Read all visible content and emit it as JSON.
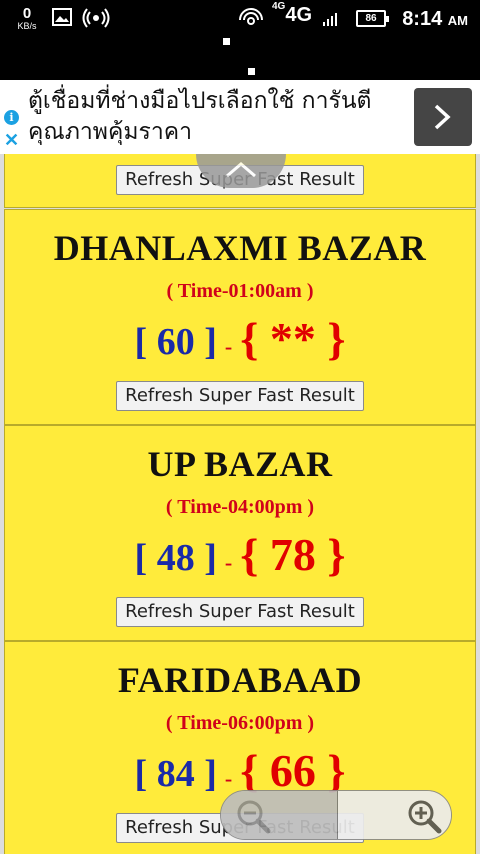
{
  "status_bar": {
    "speed_value": "0",
    "speed_unit": "KB/s",
    "network_sup": "4G",
    "network": "4G",
    "battery": "86",
    "time": "8:14",
    "ampm": "AM"
  },
  "ad": {
    "text": "ตู้เชื่อมที่ช่างมือไปรเลือกใช้ การันตีคุณภาพคุ้มราคา",
    "info_glyph": "i",
    "close_glyph": "✕"
  },
  "partial_card": {
    "refresh_label": "Refresh Super Fast Result"
  },
  "markets": [
    {
      "name": "DHANLAXMI BAZAR",
      "time": "( Time-01:00am )",
      "open": "[ 60 ]",
      "separator": "-",
      "close": "{ ** }",
      "refresh_label": "Refresh Super Fast Result"
    },
    {
      "name": "UP BAZAR",
      "time": "( Time-04:00pm )",
      "open": "[ 48 ]",
      "separator": "-",
      "close": "{ 78 }",
      "refresh_label": "Refresh Super Fast Result"
    },
    {
      "name": "FARIDABAAD",
      "time": "( Time-06:00pm )",
      "open": "[ 84 ]",
      "separator": "-",
      "close": "{ 66 }",
      "refresh_label": "Refresh Super Fast Result"
    }
  ],
  "colors": {
    "card_bg": "#ffeb3b",
    "open_number": "#1a2aa8",
    "close_number": "#e00000",
    "time_text": "#d0021b"
  }
}
